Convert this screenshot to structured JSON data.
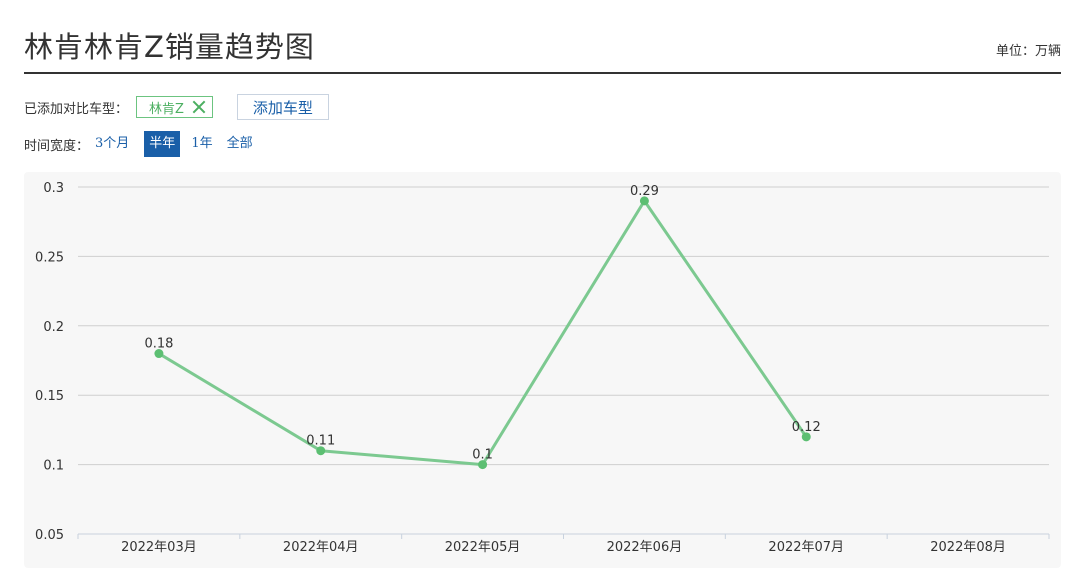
{
  "header": {
    "title": "林肯林肯Z销量趋势图",
    "unit": "单位：万辆"
  },
  "compare": {
    "label": "已添加对比车型：",
    "tags": [
      {
        "name": "林肯Z"
      }
    ],
    "add_label": "添加车型"
  },
  "time_range": {
    "label": "时间宽度：",
    "options": [
      "3个月",
      "半年",
      "1年",
      "全部"
    ],
    "selected": "半年"
  },
  "colors": {
    "line": "#7cc990",
    "point": "#5cbf72",
    "accent": "#1a5fa8"
  },
  "chart_data": {
    "type": "line",
    "categories": [
      "2022年03月",
      "2022年04月",
      "2022年05月",
      "2022年06月",
      "2022年07月",
      "2022年08月"
    ],
    "series": [
      {
        "name": "林肯Z",
        "values": [
          0.18,
          0.11,
          0.1,
          0.29,
          0.12,
          null
        ]
      }
    ],
    "data_labels": [
      "0.18",
      "0.11",
      "0.1",
      "0.29",
      "0.12"
    ],
    "yticks": [
      "0.05",
      "0.1",
      "0.15",
      "0.2",
      "0.25",
      "0.3"
    ],
    "ylim": [
      0.05,
      0.3
    ],
    "title": "",
    "xlabel": "",
    "ylabel": "",
    "grid": true,
    "legend": "none"
  }
}
